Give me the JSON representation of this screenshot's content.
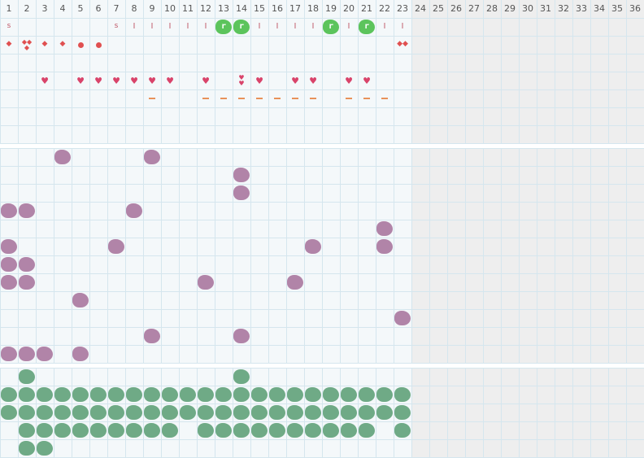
{
  "columns": [
    "1",
    "2",
    "3",
    "4",
    "5",
    "6",
    "7",
    "8",
    "9",
    "10",
    "11",
    "12",
    "13",
    "14",
    "15",
    "16",
    "17",
    "18",
    "19",
    "20",
    "21",
    "22",
    "23",
    "24",
    "25",
    "26",
    "27",
    "28",
    "29",
    "30",
    "31",
    "32",
    "33",
    "34",
    "35",
    "36"
  ],
  "active_columns": 23,
  "sections": [
    {
      "name": "top",
      "rows": 7
    },
    {
      "name": "middle",
      "rows": 12
    },
    {
      "name": "bottom",
      "rows": 5
    }
  ],
  "colors": {
    "grid_line": "#d5e6ee",
    "cell_bg": "#f4f8fa",
    "inactive_bg": "#eeeeee",
    "separator": "#ffffff",
    "purple_blob": "#b184a8",
    "teal_blob": "#6faa86",
    "green_blob": "#5cc45c"
  },
  "markers": {
    "row1": [
      {
        "col": 1,
        "t": "s"
      },
      {
        "col": 7,
        "t": "s"
      },
      {
        "col": 8,
        "t": "i"
      },
      {
        "col": 9,
        "t": "i"
      },
      {
        "col": 10,
        "t": "i"
      },
      {
        "col": 11,
        "t": "i"
      },
      {
        "col": 12,
        "t": "i"
      },
      {
        "col": 13,
        "t": "r"
      },
      {
        "col": 14,
        "t": "r"
      },
      {
        "col": 15,
        "t": "i"
      },
      {
        "col": 16,
        "t": "i"
      },
      {
        "col": 17,
        "t": "i"
      },
      {
        "col": 18,
        "t": "i"
      },
      {
        "col": 19,
        "t": "r"
      },
      {
        "col": 20,
        "t": "i"
      },
      {
        "col": 21,
        "t": "r"
      },
      {
        "col": 22,
        "t": "i"
      },
      {
        "col": 23,
        "t": "i"
      }
    ],
    "row2": [
      {
        "col": 1,
        "t": "drop"
      },
      {
        "col": 2,
        "t": "drop3"
      },
      {
        "col": 3,
        "t": "drop"
      },
      {
        "col": 4,
        "t": "drop"
      },
      {
        "col": 5,
        "t": "dot"
      },
      {
        "col": 6,
        "t": "dot"
      },
      {
        "col": 23,
        "t": "drop2"
      }
    ],
    "row4": [
      {
        "col": 3,
        "t": "heart"
      },
      {
        "col": 5,
        "t": "heart"
      },
      {
        "col": 6,
        "t": "heart"
      },
      {
        "col": 7,
        "t": "heart"
      },
      {
        "col": 8,
        "t": "heart"
      },
      {
        "col": 9,
        "t": "heart"
      },
      {
        "col": 10,
        "t": "heart"
      },
      {
        "col": 12,
        "t": "heart"
      },
      {
        "col": 14,
        "t": "heart2"
      },
      {
        "col": 15,
        "t": "heart"
      },
      {
        "col": 17,
        "t": "heart"
      },
      {
        "col": 18,
        "t": "heart"
      },
      {
        "col": 20,
        "t": "heart"
      },
      {
        "col": 21,
        "t": "heart"
      }
    ],
    "row5": [
      {
        "col": 9,
        "t": "dash"
      },
      {
        "col": 12,
        "t": "dash"
      },
      {
        "col": 13,
        "t": "dash"
      },
      {
        "col": 14,
        "t": "dash"
      },
      {
        "col": 15,
        "t": "dash"
      },
      {
        "col": 16,
        "t": "dash"
      },
      {
        "col": 17,
        "t": "dash"
      },
      {
        "col": 18,
        "t": "dash"
      },
      {
        "col": 20,
        "t": "dash"
      },
      {
        "col": 21,
        "t": "dash"
      },
      {
        "col": 22,
        "t": "dash"
      }
    ]
  },
  "marker_labels": {
    "s": "s",
    "i": "I",
    "r": "r"
  },
  "purple_cells": [
    [
      1,
      4
    ],
    [
      1,
      9
    ],
    [
      2,
      14
    ],
    [
      3,
      14
    ],
    [
      4,
      1
    ],
    [
      4,
      2
    ],
    [
      4,
      8
    ],
    [
      5,
      22
    ],
    [
      6,
      1
    ],
    [
      6,
      7
    ],
    [
      6,
      18
    ],
    [
      6,
      22
    ],
    [
      7,
      1
    ],
    [
      7,
      2
    ],
    [
      8,
      1
    ],
    [
      8,
      2
    ],
    [
      8,
      12
    ],
    [
      8,
      17
    ],
    [
      9,
      5
    ],
    [
      10,
      23
    ],
    [
      11,
      9
    ],
    [
      11,
      14
    ],
    [
      12,
      1
    ],
    [
      12,
      2
    ],
    [
      12,
      3
    ],
    [
      12,
      5
    ]
  ],
  "teal_cells": [
    [
      1,
      2
    ],
    [
      1,
      14
    ],
    [
      2,
      1
    ],
    [
      2,
      2
    ],
    [
      2,
      3
    ],
    [
      2,
      4
    ],
    [
      2,
      5
    ],
    [
      2,
      6
    ],
    [
      2,
      7
    ],
    [
      2,
      8
    ],
    [
      2,
      9
    ],
    [
      2,
      10
    ],
    [
      2,
      11
    ],
    [
      2,
      12
    ],
    [
      2,
      13
    ],
    [
      2,
      14
    ],
    [
      2,
      15
    ],
    [
      2,
      16
    ],
    [
      2,
      17
    ],
    [
      2,
      18
    ],
    [
      2,
      19
    ],
    [
      2,
      20
    ],
    [
      2,
      21
    ],
    [
      2,
      22
    ],
    [
      2,
      23
    ],
    [
      3,
      1
    ],
    [
      3,
      2
    ],
    [
      3,
      3
    ],
    [
      3,
      4
    ],
    [
      3,
      5
    ],
    [
      3,
      6
    ],
    [
      3,
      7
    ],
    [
      3,
      8
    ],
    [
      3,
      9
    ],
    [
      3,
      10
    ],
    [
      3,
      11
    ],
    [
      3,
      12
    ],
    [
      3,
      13
    ],
    [
      3,
      14
    ],
    [
      3,
      15
    ],
    [
      3,
      16
    ],
    [
      3,
      17
    ],
    [
      3,
      18
    ],
    [
      3,
      19
    ],
    [
      3,
      20
    ],
    [
      3,
      21
    ],
    [
      3,
      22
    ],
    [
      3,
      23
    ],
    [
      4,
      2
    ],
    [
      4,
      3
    ],
    [
      4,
      4
    ],
    [
      4,
      5
    ],
    [
      4,
      6
    ],
    [
      4,
      7
    ],
    [
      4,
      8
    ],
    [
      4,
      9
    ],
    [
      4,
      10
    ],
    [
      4,
      12
    ],
    [
      4,
      13
    ],
    [
      4,
      14
    ],
    [
      4,
      15
    ],
    [
      4,
      16
    ],
    [
      4,
      17
    ],
    [
      4,
      18
    ],
    [
      4,
      19
    ],
    [
      4,
      20
    ],
    [
      4,
      21
    ],
    [
      4,
      23
    ],
    [
      5,
      2
    ],
    [
      5,
      3
    ]
  ]
}
